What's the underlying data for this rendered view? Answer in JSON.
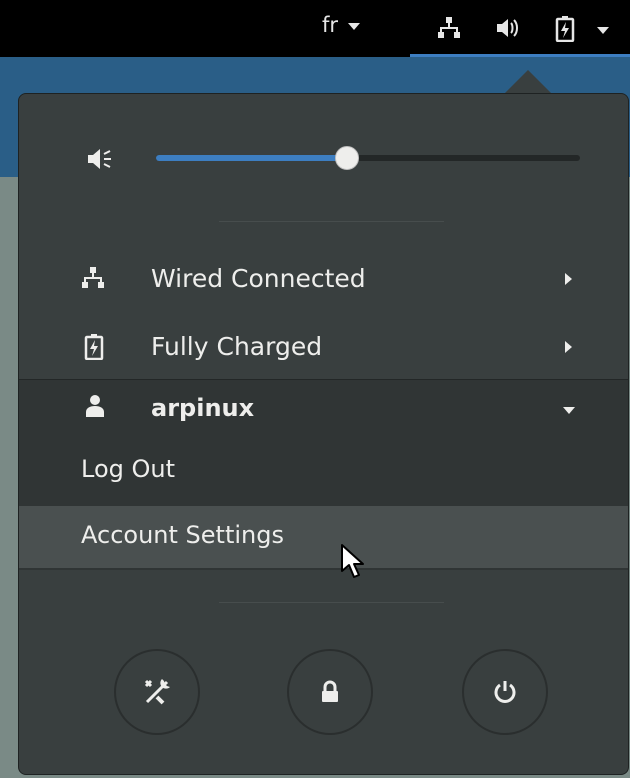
{
  "topbar": {
    "language": "fr",
    "icons": [
      "network-wired-icon",
      "volume-icon",
      "battery-charging-icon",
      "system-menu-caret-icon"
    ]
  },
  "volume": {
    "level": 0.45,
    "icon": "volume-low-icon"
  },
  "status_items": [
    {
      "label": "Wired Connected",
      "icon": "network-wired-icon"
    },
    {
      "label": "Fully Charged",
      "icon": "battery-charging-icon"
    }
  ],
  "user": {
    "name": "arpinux",
    "menu": [
      "Log Out",
      "Account Settings"
    ]
  },
  "actions": [
    "settings-icon",
    "lock-icon",
    "power-icon"
  ],
  "colors": {
    "accent": "#3d7ec1",
    "popup_bg": "#393f3f",
    "text": "#eeeeec"
  }
}
